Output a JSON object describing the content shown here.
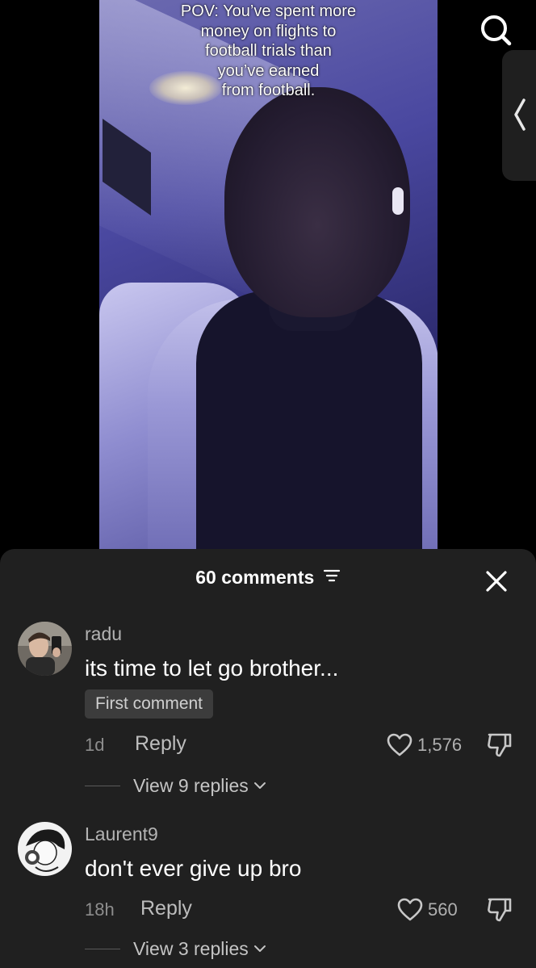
{
  "video": {
    "caption": "POV: You’ve spent more\nmoney on flights to\nfootball trials than\nyou’ve earned\nfrom football."
  },
  "comments_panel": {
    "count_label": "60 comments",
    "comments": [
      {
        "username": "radu",
        "text": "its time to let go brother...",
        "badge": "First comment",
        "time": "1d",
        "reply_label": "Reply",
        "likes": "1,576",
        "view_replies": "View 9 replies"
      },
      {
        "username": "Laurent9",
        "text": "don't ever give up bro",
        "time": "18h",
        "reply_label": "Reply",
        "likes": "560",
        "view_replies": "View 3 replies"
      }
    ]
  },
  "colors": {
    "sheet_bg": "#202020",
    "video_tint": "#4a48a0",
    "muted_text": "#b3b3b3"
  },
  "icons": [
    "search-icon",
    "chevron-left-icon",
    "filter-icon",
    "close-icon",
    "heart-icon",
    "dislike-icon",
    "chevron-down-icon"
  ]
}
